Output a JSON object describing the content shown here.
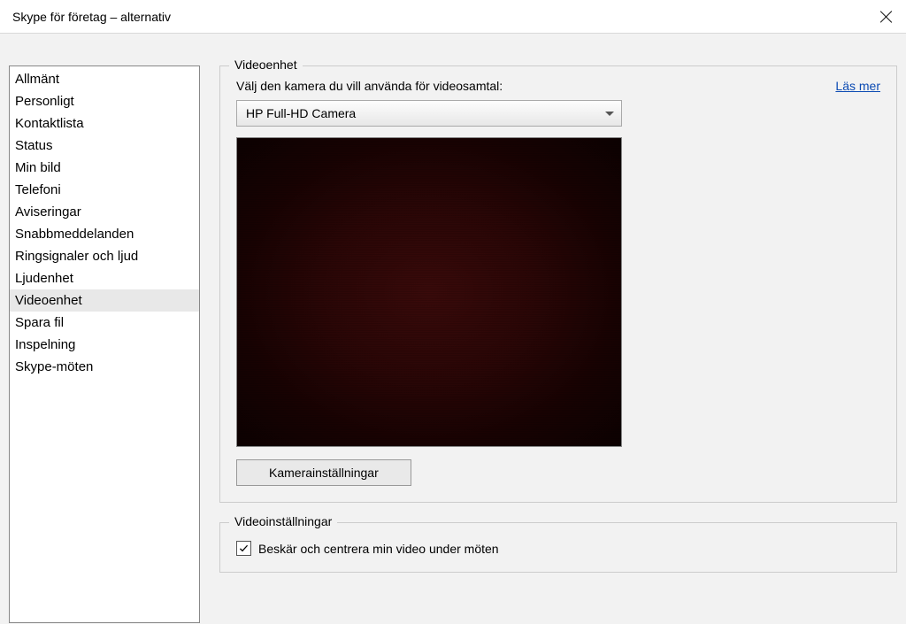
{
  "titlebar": {
    "title": "Skype för företag – alternativ"
  },
  "sidebar": {
    "items": [
      {
        "label": "Allmänt",
        "selected": false
      },
      {
        "label": "Personligt",
        "selected": false
      },
      {
        "label": "Kontaktlista",
        "selected": false
      },
      {
        "label": "Status",
        "selected": false
      },
      {
        "label": "Min bild",
        "selected": false
      },
      {
        "label": "Telefoni",
        "selected": false
      },
      {
        "label": "Aviseringar",
        "selected": false
      },
      {
        "label": "Snabbmeddelanden",
        "selected": false
      },
      {
        "label": "Ringsignaler och ljud",
        "selected": false
      },
      {
        "label": "Ljudenhet",
        "selected": false
      },
      {
        "label": "Videoenhet",
        "selected": true
      },
      {
        "label": "Spara fil",
        "selected": false
      },
      {
        "label": "Inspelning",
        "selected": false
      },
      {
        "label": "Skype-möten",
        "selected": false
      }
    ]
  },
  "videoDevice": {
    "legend": "Videoenhet",
    "instruction": "Välj den kamera du vill använda för videosamtal:",
    "learnMore": "Läs mer",
    "selectedCamera": "HP Full-HD Camera",
    "cameraSettingsButton": "Kamerainställningar"
  },
  "videoSettings": {
    "legend": "Videoinställningar",
    "cropCenterLabel": "Beskär och centrera min video under möten",
    "cropCenterChecked": true
  }
}
